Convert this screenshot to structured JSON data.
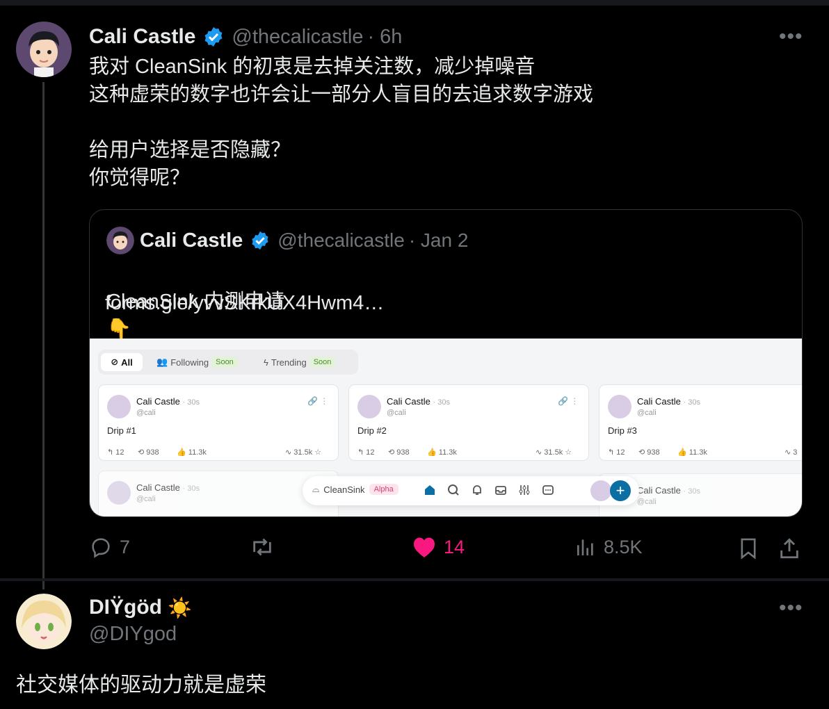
{
  "tweet": {
    "author_name": "Cali Castle",
    "handle": "@thecalicastle",
    "time": "· 6h",
    "more": "•••",
    "text": "我对 CleanSink 的初衷是去掉关注数，减少掉噪音\n这种虚荣的数字也许会让一部分人盲目的去追求数字游戏\n\n给用户选择是否隐藏？\n你觉得呢？",
    "quote": {
      "author_name": "Cali Castle",
      "handle": "@thecalicastle",
      "time": "· Jan 2",
      "text_line1": "CleanSink 内测申请",
      "emoji": "👇",
      "link": "forms.gle/yvvSKrkUX4Hwm4…",
      "screenshot": {
        "tabs": [
          {
            "label": "All"
          },
          {
            "label": "Following",
            "badge": "Soon"
          },
          {
            "label": "Trending",
            "badge": "Soon"
          }
        ],
        "cards": [
          {
            "name": "Cali Castle",
            "time": "· 30s",
            "handle": "@cali",
            "text": "Drip #1",
            "replies": "12",
            "reposts": "938",
            "likes": "11.3k",
            "views": "31.5k"
          },
          {
            "name": "Cali Castle",
            "time": "· 30s",
            "handle": "@cali",
            "text": "Drip #2",
            "replies": "12",
            "reposts": "938",
            "likes": "11.3k",
            "views": "31.5k"
          },
          {
            "name": "Cali Castle",
            "time": "· 30s",
            "handle": "@cali",
            "text": "Drip #3",
            "replies": "12",
            "reposts": "938",
            "likes": "11.3k",
            "views": "3"
          }
        ],
        "bottom_cards": [
          {
            "name": "Cali Castle",
            "time": "· 30s",
            "handle": "@cali"
          },
          {
            "name": "Cali Castle",
            "time": "· 30s",
            "handle": "@cali"
          }
        ],
        "dock": {
          "app_name": "CleanSink",
          "badge": "Alpha"
        }
      }
    },
    "actions": {
      "replies": "7",
      "reposts": "",
      "likes": "14",
      "views": "8.5K"
    },
    "colors": {
      "like": "#f91880",
      "verified": "#1d9bf0"
    }
  },
  "reply": {
    "author_name": "DIŸgöd",
    "emoji": "☀️",
    "handle": "@DIYgod",
    "more": "•••",
    "text": "社交媒体的驱动力就是虚荣"
  }
}
